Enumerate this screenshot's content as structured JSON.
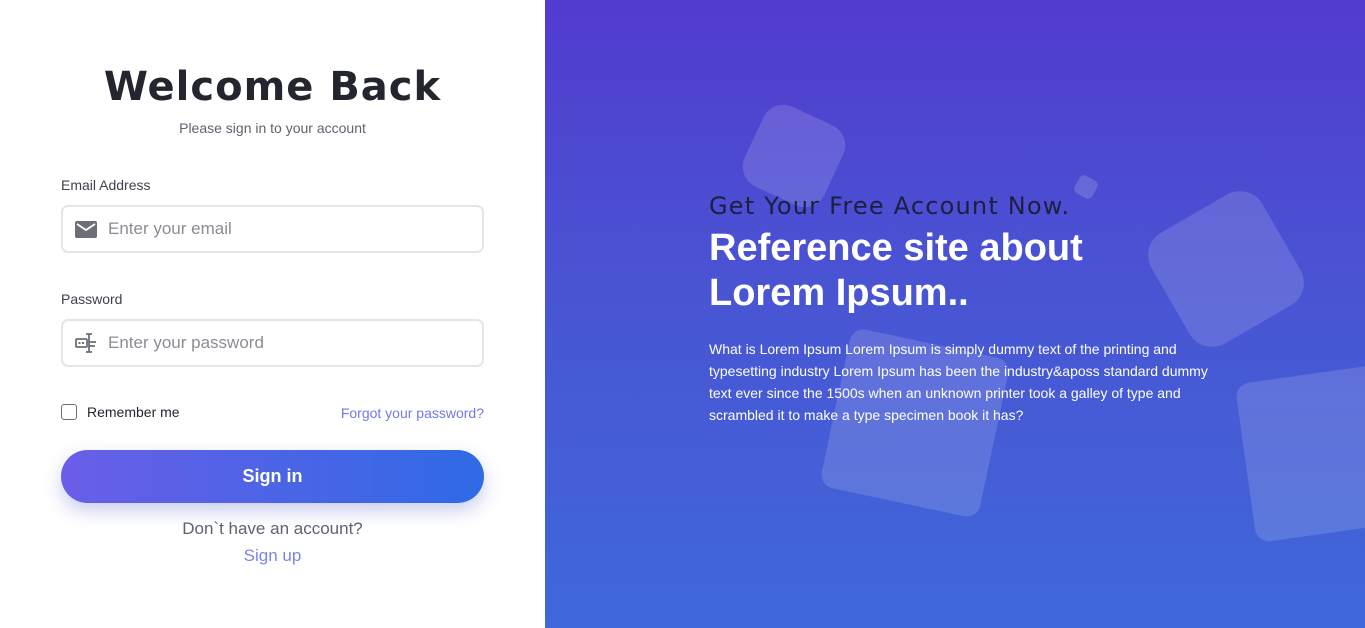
{
  "login": {
    "title": "Welcome Back",
    "subtitle": "Please sign in to your account",
    "email": {
      "label": "Email Address",
      "placeholder": "Enter your email",
      "icon": "mail-icon"
    },
    "password": {
      "label": "Password",
      "placeholder": "Enter your password",
      "icon": "password-icon"
    },
    "remember_label": "Remember me",
    "forgot_label": "Forgot your password?",
    "signin_label": "Sign in",
    "no_account_text": "Don`t have an account?",
    "signup_label": "Sign up"
  },
  "promo": {
    "kicker": "Get Your Free Account Now.",
    "headline": "Reference site about Lorem Ipsum..",
    "body": "What is Lorem Ipsum Lorem Ipsum is simply dummy text of the printing and typesetting industry Lorem Ipsum has been the industry&aposs standard dummy text ever since the 1500s when an unknown printer took a galley of type and scrambled it to make a type specimen book it has?"
  },
  "colors": {
    "accent": "#6f7ae8",
    "button_start": "#6a5ee8",
    "button_end": "#2f6ae5",
    "panel_top": "#523bcf",
    "panel_bottom": "#3f68da"
  }
}
